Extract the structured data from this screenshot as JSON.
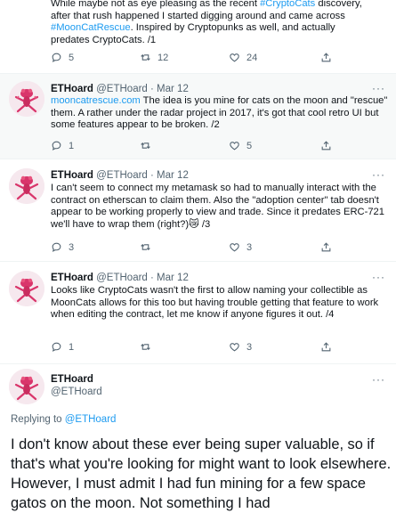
{
  "tweet0": {
    "text_line1": "While maybe not as eye pleasing as the recent ",
    "hashtag1": "#CryptoCats",
    "text_line1b": " discovery,",
    "text_line2": "after that rush happened I started digging around and came across",
    "hashtag2": "#MoonCatRescue",
    "text_line3": ". Inspired by Cryptopunks as well, and actually",
    "text_line4": "predates CryptoCats. /1",
    "replies": "5",
    "retweets": "12",
    "likes": "24"
  },
  "tweet1": {
    "name": "ETHoard",
    "handle": "@ETHoard",
    "date": "· Mar 12",
    "link": "mooncatrescue.com",
    "text": " The idea is you mine for cats on the moon and \"rescue\" them. A rather under the radar project in 2017, it's got that cool retro UI but some features appear to be broken. /2",
    "replies": "1",
    "likes": "5"
  },
  "tweet2": {
    "name": "ETHoard",
    "handle": "@ETHoard",
    "date": "· Mar 12",
    "text": "I can't seem to connect my metamask so had to manually interact with the contract on etherscan to claim them. Also the \"adoption center\" tab doesn't appear to be working properly to view and trade. Since it predates ERC-721 we'll have to wrap them (right?)",
    "emoji": "😿",
    "suffix": " /3",
    "replies": "3",
    "likes": "3"
  },
  "tweet3": {
    "name": "ETHoard",
    "handle": "@ETHoard",
    "date": "· Mar 12",
    "text": "Looks like CryptoCats wasn't the first to allow naming your collectible as MoonCats allows for this too but having trouble getting that feature to work when editing the contract, let me know if anyone figures it out. /4",
    "replies": "1",
    "likes": "3"
  },
  "main": {
    "name": "ETHoard",
    "handle": "@ETHoard",
    "replying_prefix": "Replying to ",
    "replying_handle": "@ETHoard",
    "text": "I don't know about these ever being super valuable, so if that's what you're looking for might want to look elsewhere. However, I must admit I had fun mining for a few space gatos on the moon. Not something I had"
  },
  "colors": {
    "accent": "#1d9bf0",
    "muted": "#536471",
    "highlight_bg": "#f7f9f9"
  }
}
